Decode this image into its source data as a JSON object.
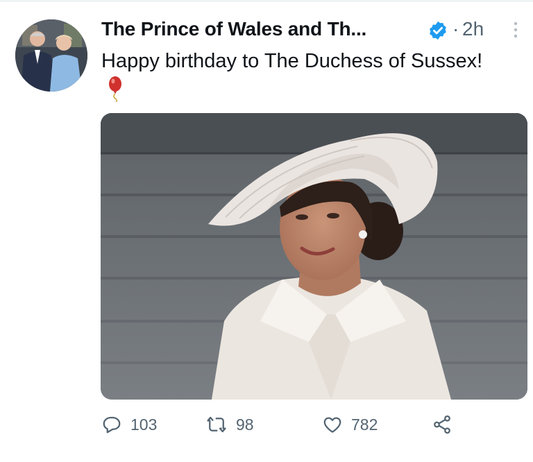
{
  "tweet": {
    "author": "The Prince of Wales and Th...",
    "separator": "·",
    "time": "2h",
    "text": "Happy birthday to The Duchess of Sussex!",
    "reply_count": "103",
    "retweet_count": "98",
    "like_count": "782"
  },
  "icons": {
    "verified": "verified-badge-icon",
    "more": "more-vertical-icon",
    "balloon": "balloon-emoji",
    "reply": "reply-icon",
    "retweet": "retweet-icon",
    "like": "heart-icon",
    "share": "share-icon"
  },
  "colors": {
    "verified": "#1d9bf0",
    "secondary_text": "#536471",
    "text": "#0f1419"
  }
}
